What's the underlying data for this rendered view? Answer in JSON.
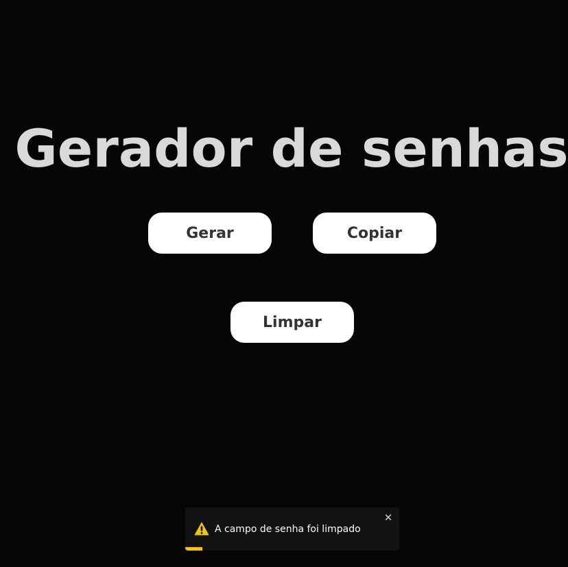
{
  "page": {
    "title": "Gerador de senhas"
  },
  "buttons": {
    "generate_label": "Gerar",
    "copy_label": "Copiar",
    "clear_label": "Limpar"
  },
  "toast": {
    "icon": "warning-icon",
    "message": "A campo de senha foi limpado",
    "close_symbol": "✕",
    "progress_fraction": 0.08,
    "accent_color": "#f1c40f"
  },
  "colors": {
    "background": "#060606",
    "title": "#d9d9d9",
    "button_bg": "#ffffff",
    "button_text": "#333333",
    "toast_bg": "#121212"
  }
}
